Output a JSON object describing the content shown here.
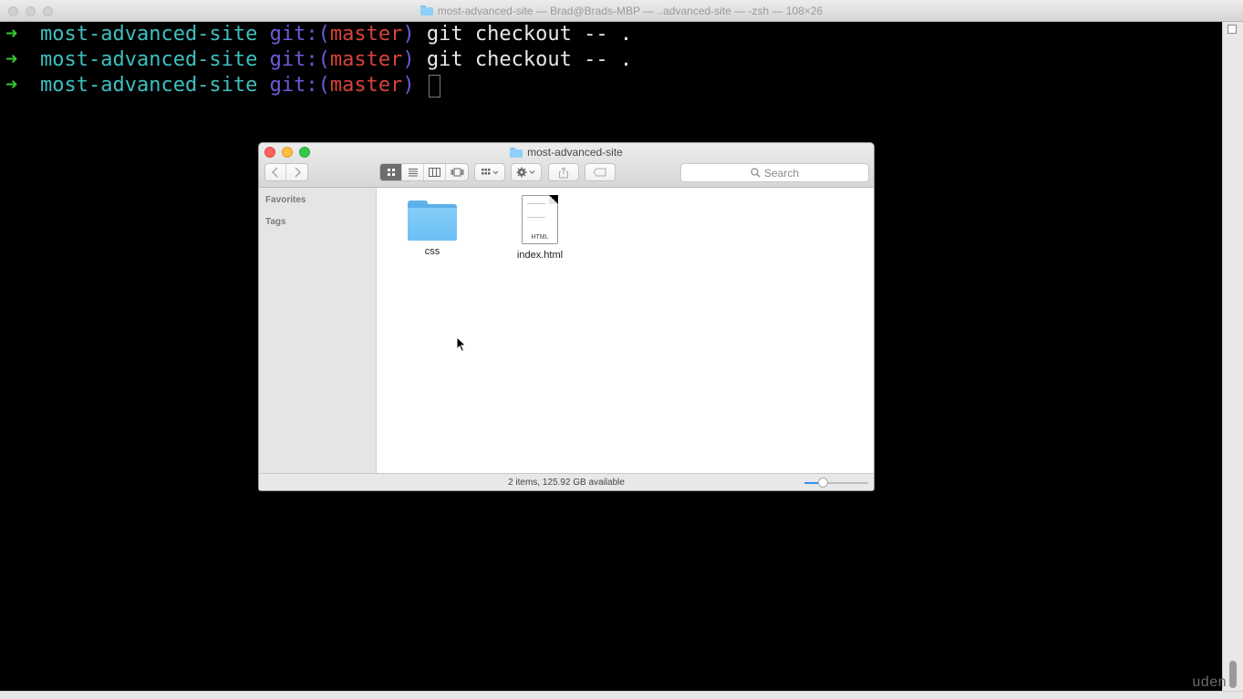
{
  "terminal": {
    "title": "most-advanced-site — Brad@Brads-MBP — ..advanced-site — -zsh — 108×26",
    "lines": [
      {
        "arrow": "➜",
        "dir": "most-advanced-site",
        "git": "git:(",
        "branch": "master",
        "git_close": ")",
        "cmd": "git checkout -- ."
      },
      {
        "arrow": "➜",
        "dir": "most-advanced-site",
        "git": "git:(",
        "branch": "master",
        "git_close": ")",
        "cmd": "git checkout -- ."
      },
      {
        "arrow": "➜",
        "dir": "most-advanced-site",
        "git": "git:(",
        "branch": "master",
        "git_close": ")",
        "cmd": ""
      }
    ],
    "watermark": "uden"
  },
  "finder": {
    "title": "most-advanced-site",
    "search_placeholder": "Search",
    "sidebar": {
      "favorites": "Favorites",
      "tags": "Tags"
    },
    "items": [
      {
        "name": "css",
        "type": "folder"
      },
      {
        "name": "index.html",
        "type": "html",
        "badge": "HTML"
      }
    ],
    "status": "2 items, 125.92 GB available",
    "zoom_level": 0.25
  },
  "colors": {
    "arrow": "#37c832",
    "dir": "#3fbfc0",
    "git": "#6b5cd8",
    "branch": "#d8433b",
    "folder": "#6cbff5",
    "accent": "#3a8ef5"
  }
}
